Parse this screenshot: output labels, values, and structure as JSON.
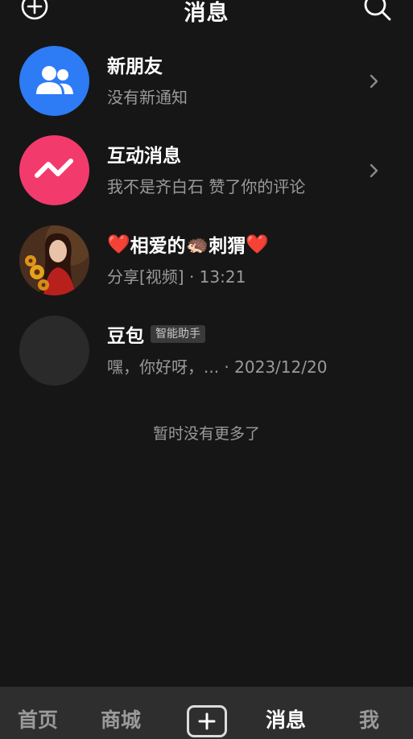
{
  "header": {
    "title": "消息",
    "add_icon": "plus-circle-icon",
    "search_icon": "search-icon"
  },
  "conversations": [
    {
      "name": "新朋友",
      "subtitle": "没有新通知",
      "avatar_icon": "people-icon",
      "avatar_color": "#2d7bf5",
      "has_chevron": true
    },
    {
      "name": "互动消息",
      "subtitle": "我不是齐白石 赞了你的评论",
      "avatar_icon": "zigzag-icon",
      "avatar_color": "#f23b6c",
      "has_chevron": true
    },
    {
      "name_prefix": "❤️",
      "name_main": "相爱的",
      "name_emoji": "🦔",
      "name_mid": "刺猬",
      "name_suffix": "❤️",
      "subtitle": "分享[视频] · 13:21",
      "avatar_icon": "photo-avatar"
    },
    {
      "name": "豆包",
      "badge": "智能助手",
      "subtitle": "嘿，你好呀，... · 2023/12/20",
      "avatar_icon": "dark-avatar",
      "avatar_color": "#2a2a2a"
    }
  ],
  "end_note": "暂时没有更多了",
  "tabbar": {
    "tabs": [
      "首页",
      "商城",
      "消息",
      "我"
    ],
    "active": "消息",
    "plus_icon": "plus-icon"
  },
  "colors": {
    "background": "#161616",
    "tabbar_bg": "#2e2e2e",
    "secondary_text": "#9a9a9a"
  }
}
